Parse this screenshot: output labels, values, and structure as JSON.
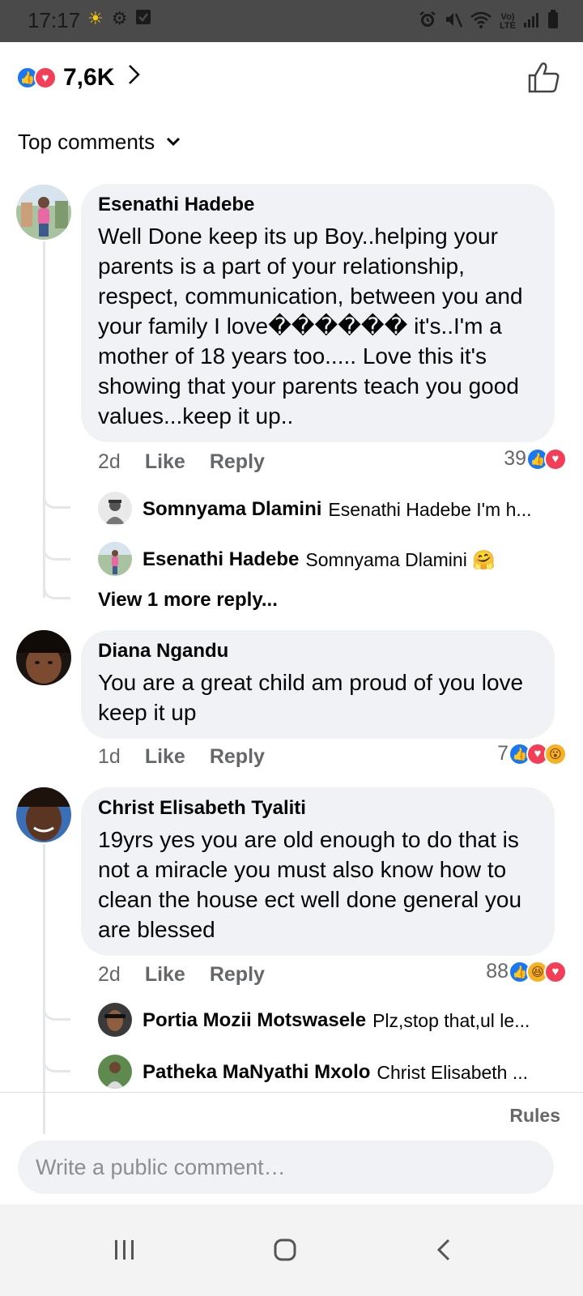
{
  "status_bar": {
    "time": "17:17",
    "left_icons": [
      "sun-icon",
      "gear-icon",
      "check-box-icon"
    ],
    "right_icons": [
      "alarm-icon",
      "mute-icon",
      "wifi-icon",
      "volte-icon",
      "signal-icon",
      "battery-icon"
    ],
    "volte_text": "Vo) LTE"
  },
  "header": {
    "reaction_icons": [
      "like-reaction-icon",
      "love-reaction-icon"
    ],
    "reaction_count": "7,6K"
  },
  "sort": {
    "label": "Top comments"
  },
  "comments": [
    {
      "author": "Esenathi Hadebe",
      "body": "Well Done keep its up Boy..helping your parents is a part of your relationship, respect, communication, between you and your family I love������ it's..I'm a mother of 18 years too..... Love this it's showing that your parents teach you good values...keep it up..",
      "age": "2d",
      "like_label": "Like",
      "reply_label": "Reply",
      "reaction_count": "39",
      "reactions": [
        "like",
        "love"
      ],
      "replies": [
        {
          "name": "Somnyama Dlamini",
          "text": "Esenathi Hadebe I'm  h..."
        },
        {
          "name": "Esenathi Hadebe",
          "text": "Somnyama Dlamini 🤗"
        }
      ],
      "view_more": "View 1 more reply..."
    },
    {
      "author": "Diana Ngandu",
      "body": "You are a great child am proud of you love keep it up",
      "age": "1d",
      "like_label": "Like",
      "reply_label": "Reply",
      "reaction_count": "7",
      "reactions": [
        "like",
        "love",
        "wow"
      ]
    },
    {
      "author": "Christ Elisabeth Tyaliti",
      "body": "19yrs yes you are old enough to do that is not a miracle you must also know how to clean the house ect well done general you are blessed",
      "age": "2d",
      "like_label": "Like",
      "reply_label": "Reply",
      "reaction_count": "88",
      "reactions": [
        "like",
        "haha",
        "love"
      ],
      "replies": [
        {
          "name": "Portia Mozii Motswasele",
          "text": "Plz,stop that,ul le..."
        },
        {
          "name": "Patheka MaNyathi Mxolo",
          "text": "Christ Elisabeth ..."
        }
      ]
    }
  ],
  "footer": {
    "rules_label": "Rules",
    "comment_placeholder": "Write a public comment…"
  },
  "nav": [
    "recent-apps-icon",
    "home-icon",
    "back-icon"
  ],
  "colors": {
    "like_blue": "#1877f2",
    "love_red": "#f33e58",
    "bubble_gray": "#f0f2f5",
    "secondary_text": "#65676b"
  }
}
